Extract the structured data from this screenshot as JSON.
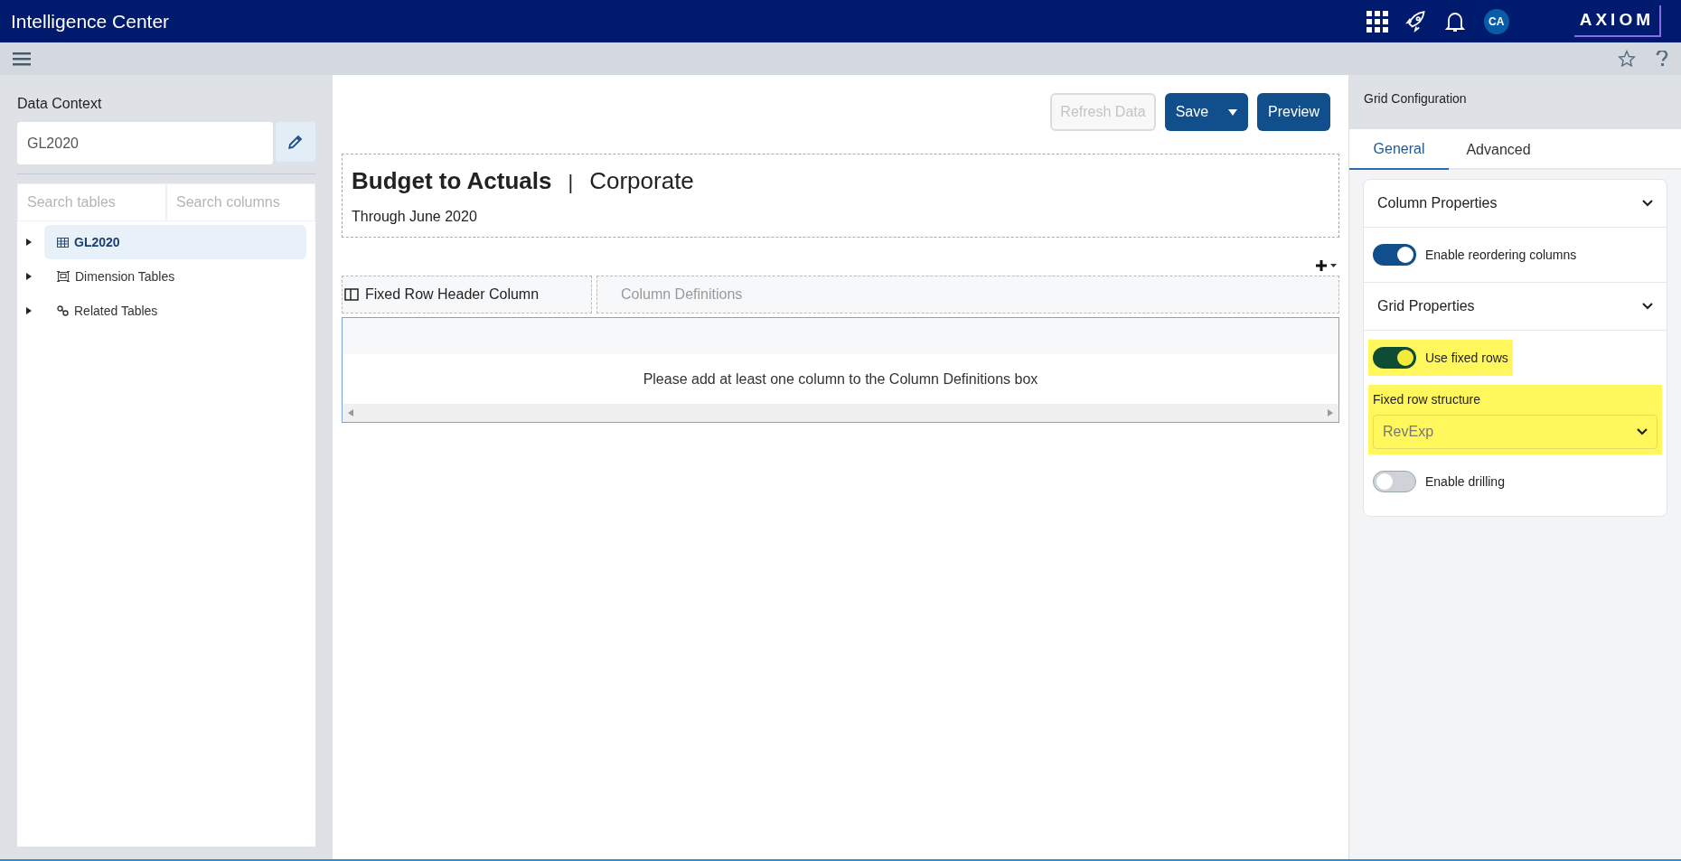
{
  "app_bar": {
    "title": "Intelligence Center",
    "avatar": "CA",
    "logo": "AXIOM"
  },
  "data_context": {
    "label": "Data Context",
    "value": "GL2020"
  },
  "search": [
    {
      "placeholder": "Search tables"
    },
    {
      "placeholder": "Search columns"
    }
  ],
  "tree": [
    {
      "label": "GL2020",
      "kind": "table",
      "selected": true,
      "expanded": false
    },
    {
      "label": "Dimension Tables",
      "kind": "dimension",
      "selected": false,
      "expanded": false
    },
    {
      "label": "Related Tables",
      "kind": "related",
      "selected": false,
      "expanded": false
    }
  ],
  "toolbar": [
    {
      "label": "Refresh Data",
      "disabled": true,
      "dropdown": false
    },
    {
      "label": "Save",
      "disabled": false,
      "dropdown": true
    },
    {
      "label": "Preview",
      "disabled": false,
      "dropdown": false
    }
  ],
  "report": {
    "title": "Budget to Actuals",
    "separator": "|",
    "subtitle": "Corporate",
    "period": "Through June 2020"
  },
  "grid": {
    "fixed_header": "Fixed Row Header Column",
    "columns_placeholder": "Column Definitions",
    "empty_message": "Please add at least one column to the Column Definitions box"
  },
  "config": {
    "title": "Grid Configuration",
    "tabs": [
      {
        "label": "General",
        "selected": true
      },
      {
        "label": "Advanced",
        "selected": false
      }
    ],
    "sections": [
      {
        "title": "Column Properties",
        "items": [
          {
            "kind": "toggle",
            "label": "Enable reordering columns",
            "on": true,
            "highlighted": false
          }
        ]
      },
      {
        "title": "Grid Properties",
        "items": [
          {
            "kind": "toggle",
            "label": "Use fixed rows",
            "on": true,
            "highlighted": true
          },
          {
            "kind": "select",
            "label": "Fixed row structure",
            "value": "RevExp",
            "highlighted": true
          },
          {
            "kind": "toggle",
            "label": "Enable drilling",
            "on": false,
            "highlighted": false
          }
        ]
      }
    ]
  }
}
